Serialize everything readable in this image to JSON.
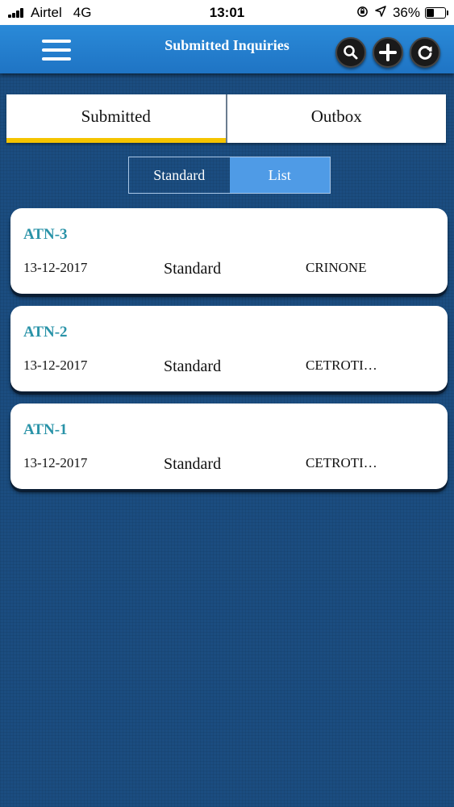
{
  "status_bar": {
    "carrier": "Airtel",
    "network": "4G",
    "time": "13:01",
    "battery": "36%",
    "battery_level": 0.36
  },
  "header": {
    "title": "Submitted Inquiries"
  },
  "tabs": [
    {
      "label": "Submitted",
      "active": true
    },
    {
      "label": "Outbox",
      "active": false
    }
  ],
  "view_toggle": [
    {
      "label": "Standard",
      "selected": false
    },
    {
      "label": "List",
      "selected": true
    }
  ],
  "inquiries": [
    {
      "id": "ATN-3",
      "date": "13-12-2017",
      "type": "Standard",
      "product": "CRINONE"
    },
    {
      "id": "ATN-2",
      "date": "13-12-2017",
      "type": "Standard",
      "product": "CETROTI…"
    },
    {
      "id": "ATN-1",
      "date": "13-12-2017",
      "type": "Standard",
      "product": "CETROTI…"
    }
  ],
  "colors": {
    "background": "#1b4d80",
    "header": "#2280cf",
    "tab_indicator": "#f5c400",
    "segment_selected": "#4f9be6",
    "inquiry_id": "#2a93a8"
  },
  "icons": {
    "menu": "hamburger-menu-icon",
    "search": "search-icon",
    "add": "plus-icon",
    "refresh": "refresh-icon"
  }
}
